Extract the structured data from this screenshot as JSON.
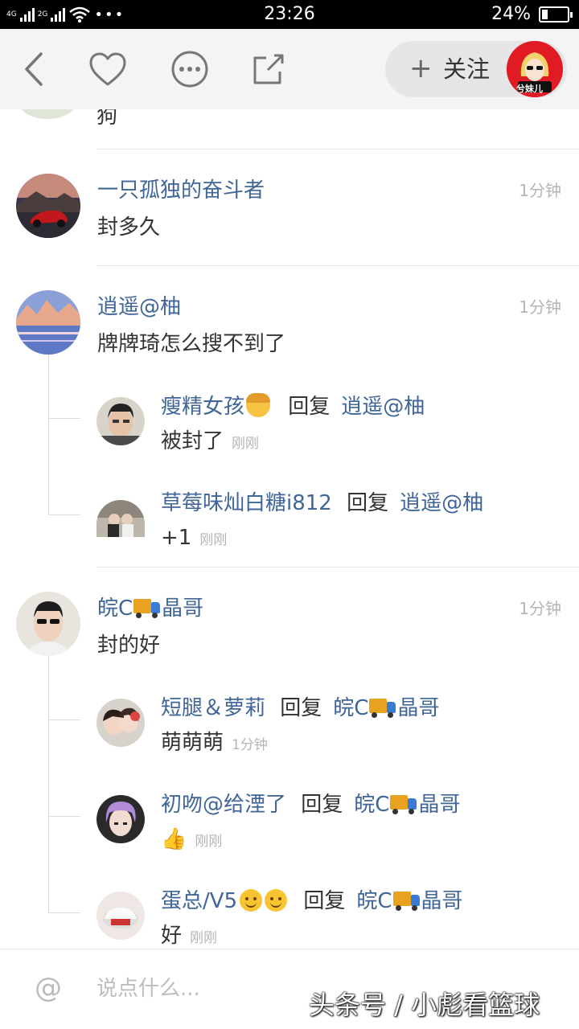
{
  "status_bar": {
    "net1": "4G",
    "net2": "2G",
    "time": "23:26",
    "battery_percent": "24%",
    "battery_level": 0.24
  },
  "nav": {
    "follow_label": "关注",
    "follow_plus": "+",
    "avatar_text": "兮妹儿"
  },
  "comments": [
    {
      "partial_text": "狗"
    },
    {
      "name": "一只孤独的奋斗者",
      "time": "1分钟",
      "text": "封多久"
    },
    {
      "name": "逍遥@柚",
      "time": "1分钟",
      "text": "牌牌琦怎么搜不到了",
      "replies": [
        {
          "name": "瘦精女孩",
          "reply_word": "回复",
          "target": "逍遥@柚",
          "text": "被封了",
          "time": "刚刚"
        },
        {
          "name": "草莓味灿白糖i812",
          "reply_word": "回复",
          "target": "逍遥@柚",
          "text": "+1",
          "time": "刚刚"
        }
      ]
    },
    {
      "name_pre": "皖C",
      "name_post": "晶哥",
      "time": "1分钟",
      "text": "封的好",
      "replies": [
        {
          "name": "短腿＆萝莉",
          "reply_word": "回复",
          "target_pre": "皖C",
          "target_post": "晶哥",
          "text": "萌萌萌",
          "time": "1分钟"
        },
        {
          "name": "初吻@给湮了",
          "reply_word": "回复",
          "target_pre": "皖C",
          "target_post": "晶哥",
          "text": "👍",
          "time": "刚刚"
        },
        {
          "name": "蛋总/V5",
          "reply_word": "回复",
          "target_pre": "皖C",
          "target_post": "晶哥",
          "text": "好",
          "time": "刚刚"
        }
      ]
    }
  ],
  "bottom": {
    "at": "@",
    "placeholder": "说点什么...",
    "watermark": "头条号 / 小彪看篮球"
  },
  "colors": {
    "name_blue": "#406599",
    "time_gray": "#b5b5b5",
    "nav_bg": "#f4f4f4"
  }
}
